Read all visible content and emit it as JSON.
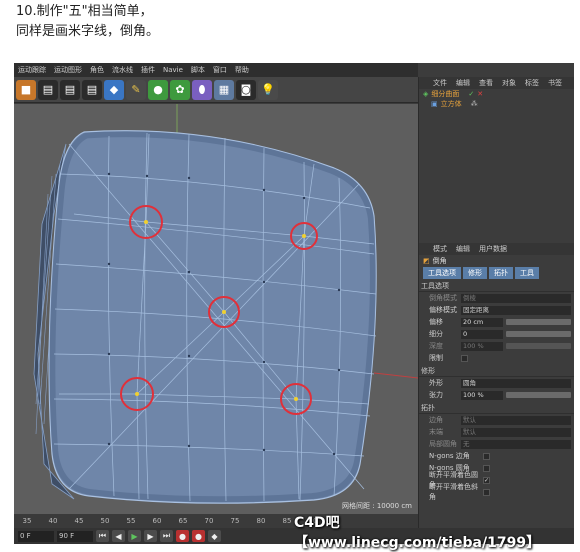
{
  "caption": {
    "line1": "10.制作\"五\"相当简单，",
    "line2": "同样是画米字线，倒角。"
  },
  "menubar": [
    "运动跟踪",
    "运动图形",
    "角色",
    "流水线",
    "插件",
    "Navie",
    "脚本",
    "窗口",
    "帮助"
  ],
  "toolbar": {
    "icons": [
      "cube-icon",
      "clapper-icon",
      "clapper-icon",
      "clapper-icon",
      "cube-blue-icon",
      "pen-icon",
      "nurbs-icon",
      "array-icon",
      "deformer-icon",
      "floor-icon",
      "camera-icon",
      "light-icon"
    ]
  },
  "viewport": {
    "status": "网格间距 : 10000 cm"
  },
  "timeline": {
    "ticks": [
      "35",
      "40",
      "45",
      "50",
      "55",
      "60",
      "65",
      "70",
      "75",
      "80",
      "85",
      "90"
    ]
  },
  "playbar": {
    "frame_start": "0 F",
    "frame_end": "90 F"
  },
  "object_manager": {
    "tabs": [
      "文件",
      "编辑",
      "查看",
      "对象",
      "标签",
      "书签"
    ],
    "objects": [
      {
        "name": "细分曲面",
        "color": "#e6a23c"
      },
      {
        "name": "立方体",
        "color": "#e6a23c"
      }
    ]
  },
  "attribute_manager": {
    "tabs": [
      "模式",
      "编辑",
      "用户数据"
    ],
    "title": "倒角",
    "subtabs": [
      "工具选项",
      "修形",
      "拓扑",
      "工具"
    ],
    "sections": {
      "tool": "工具选项",
      "shape": "修形",
      "topology": "拓扑"
    },
    "props": {
      "mode": {
        "label": "倒角模式",
        "value": "倒棱"
      },
      "offset_mode": {
        "label": "偏移模式",
        "value": "固定距离"
      },
      "offset": {
        "label": "偏移",
        "value": "20 cm"
      },
      "subdivision": {
        "label": "细分",
        "value": "0"
      },
      "depth": {
        "label": "深度",
        "value": "100 %"
      },
      "limit": {
        "label": "限制"
      },
      "shape": {
        "label": "外形",
        "value": "圆角"
      },
      "tension": {
        "label": "张力",
        "value": "100 %"
      },
      "corner": {
        "label": "边角",
        "value": "默认"
      },
      "end": {
        "label": "末端",
        "value": "默认"
      },
      "round_corner": {
        "label": "局部圆角",
        "value": "无"
      },
      "ngons_corner": {
        "label": "N-gons 边角"
      },
      "ngons_round": {
        "label": "N-gons 圆角"
      },
      "break_smooth_round": {
        "label": "断开平滑着色圆角"
      },
      "break_smooth_miter": {
        "label": "断开平滑着色斜角"
      }
    }
  },
  "watermark": "C4D吧 【www.linecg.com/tieba/1799】",
  "colors": {
    "accent": "#5a7ea8",
    "highlight_circle": "#e0303a",
    "mesh": "#6c84a8",
    "wire": "#9fb8db"
  }
}
